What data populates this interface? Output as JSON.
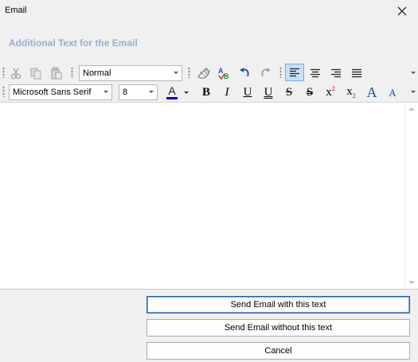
{
  "window": {
    "title": "Email"
  },
  "dialog": {
    "heading": "Additional Text for the Email"
  },
  "toolbar": {
    "style_value": "Normal",
    "font_value": "Microsoft Sans Serif",
    "size_value": "8",
    "font_color_glyph": "A",
    "bold_glyph": "B",
    "italic_glyph": "I",
    "underline_glyph": "U",
    "double_underline_glyph": "U",
    "strike_glyph": "S",
    "double_strike_glyph": "S",
    "superscript_base": "x",
    "superscript_mark": "2",
    "subscript_base": "x",
    "subscript_mark": "2",
    "grow_glyph": "A",
    "shrink_glyph": "A",
    "active_alignment": "left",
    "font_color": "#0000c8"
  },
  "buttons": {
    "send_with_text": "Send Email with this text",
    "send_without_text": "Send Email without this text",
    "cancel": "Cancel"
  }
}
